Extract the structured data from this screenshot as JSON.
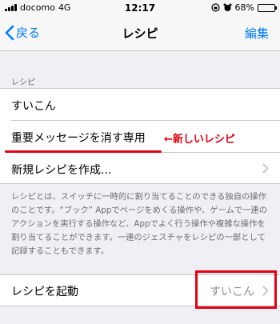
{
  "status_bar": {
    "carrier": "docomo",
    "network": "4G",
    "time": "12:17",
    "battery": "68%",
    "battery_level": 0.68
  },
  "nav": {
    "back_label": "戻る",
    "title": "レシピ",
    "edit_label": "編集"
  },
  "section": {
    "header": "レシピ"
  },
  "recipes": [
    {
      "label": "すいこん"
    },
    {
      "label": "重要メッセージを消す専用"
    },
    {
      "label": "新規レシピを作成..."
    }
  ],
  "annotation": {
    "text": "←新しいレシピ",
    "color": "#e60012"
  },
  "footer": {
    "text": "レシピとは、スイッチに一時的に割り当てることのできる独自の操作のことです。“ブック” Appでページをめくる操作や、ゲームで一連のアクションを実行する操作など、Appでよく行う操作や複雑な操作を割り当てることができます。一連のジェスチャをレシピの一部として記録することもできます。"
  },
  "launch": {
    "label": "レシピを起動",
    "value": "すいこん"
  },
  "colors": {
    "accent": "#007aff",
    "background": "#efeff4"
  }
}
